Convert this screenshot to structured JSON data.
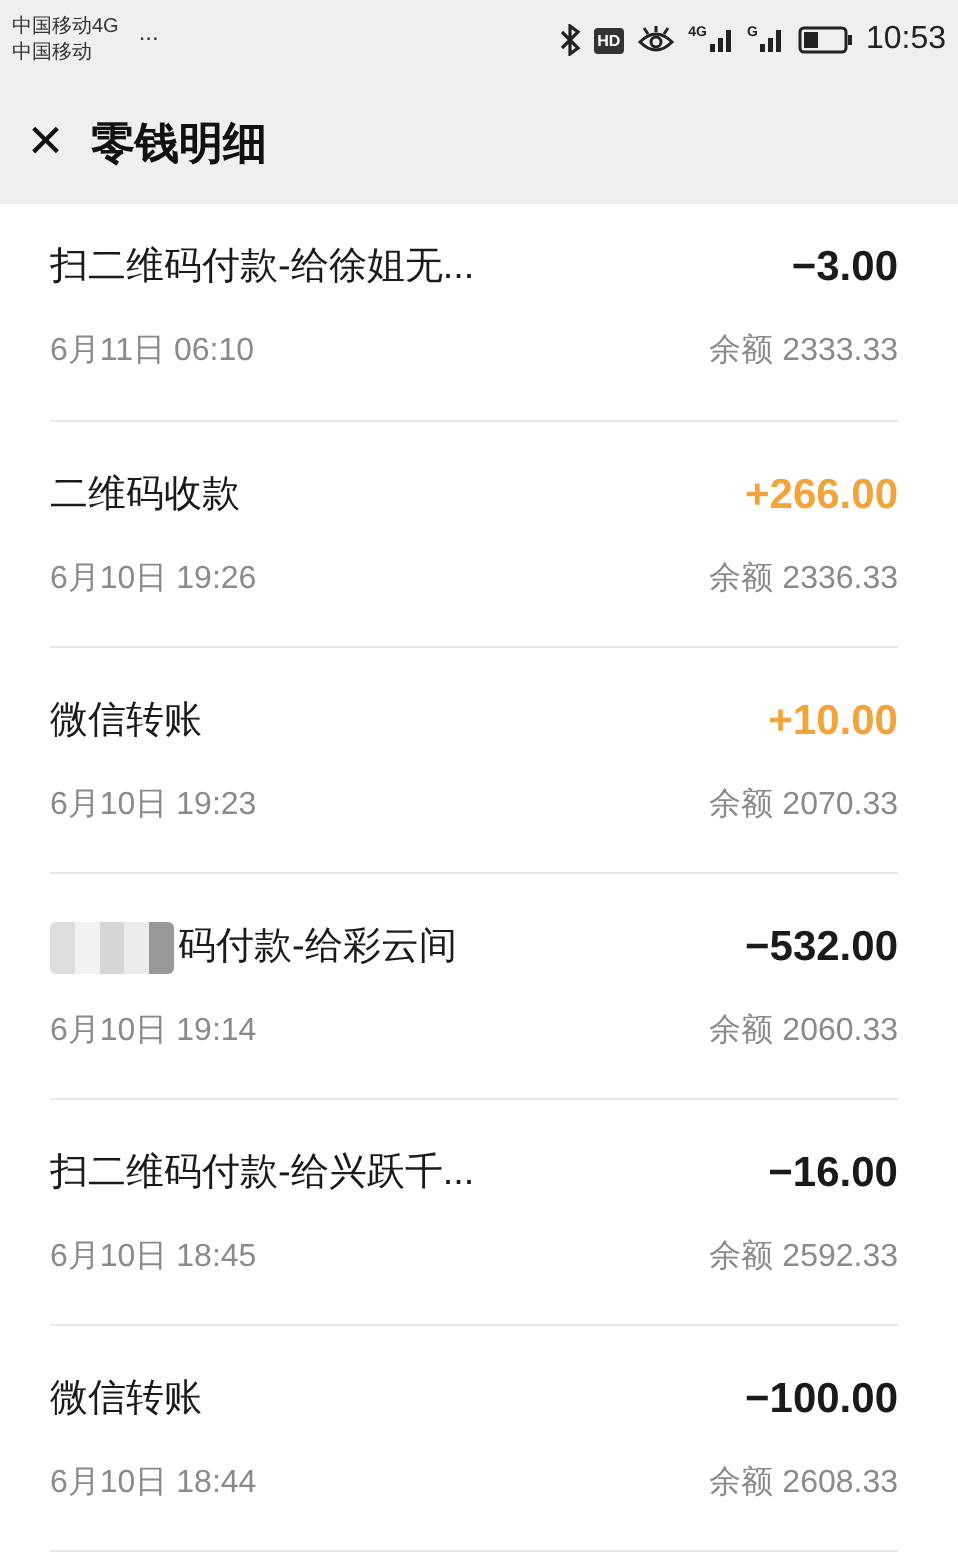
{
  "status_bar": {
    "carrier_1": "中国移动4G",
    "carrier_2": "中国移动",
    "more": "...",
    "hd": "HD",
    "sim_1_network": "4G",
    "sim_2_network": "G",
    "time": "10:53"
  },
  "header": {
    "close": "×",
    "title": "零钱明细"
  },
  "transactions": [
    {
      "title": "扫二维码付款-给徐姐无...",
      "date": "6月11日 06:10",
      "amount": "−3.00",
      "kind": "expense",
      "balance": "余额 2333.33"
    },
    {
      "title": "二维码收款",
      "date": "6月10日 19:26",
      "amount": "+266.00",
      "kind": "income",
      "balance": "余额 2336.33"
    },
    {
      "title": "微信转账",
      "date": "6月10日 19:23",
      "amount": "+10.00",
      "kind": "income",
      "balance": "余额 2070.33"
    },
    {
      "title": "码付款-给彩云间",
      "date": "6月10日 19:14",
      "amount": "−532.00",
      "kind": "expense",
      "balance": "余额 2060.33",
      "obscured": true
    },
    {
      "title": "扫二维码付款-给兴跃千...",
      "date": "6月10日 18:45",
      "amount": "−16.00",
      "kind": "expense",
      "balance": "余额 2592.33"
    },
    {
      "title": "微信转账",
      "date": "6月10日 18:44",
      "amount": "−100.00",
      "kind": "expense",
      "balance": "余额 2608.33"
    }
  ]
}
